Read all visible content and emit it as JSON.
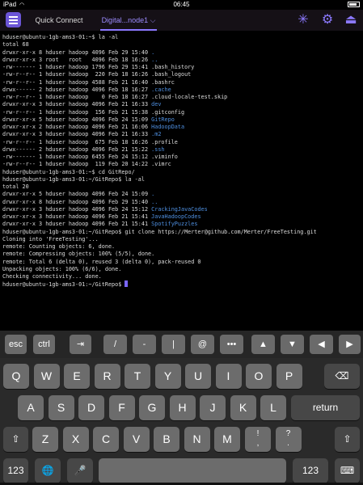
{
  "status": {
    "device": "iPad",
    "wifi": "wifi-icon",
    "time": "06:45",
    "battery": "battery-icon"
  },
  "nav": {
    "menu_icon": "menu-icon",
    "tabs": [
      {
        "label": "Quick Connect"
      },
      {
        "label": "Digital...node1 ⌵"
      }
    ],
    "icons": [
      "sparkle-icon",
      "gear-icon",
      "eject-icon"
    ],
    "accent": "#8c79ff"
  },
  "terminal": {
    "lines": [
      [
        {
          "t": "hduser@ubuntu-1gb-ams3-01:~$ la -al"
        }
      ],
      [
        {
          "t": "total 68"
        }
      ],
      [
        {
          "t": "drwxr-xr-x 8 hduser hadoop 4096 Feb 29 15:40 "
        },
        {
          "t": ".",
          "c": "blue"
        }
      ],
      [
        {
          "t": "drwxr-xr-x 3 root   root   4096 Feb 18 16:26 "
        },
        {
          "t": "..",
          "c": "blue"
        }
      ],
      [
        {
          "t": "-rw------- 1 hduser hadoop 1796 Feb 29 15:41 .bash_history"
        }
      ],
      [
        {
          "t": "-rw-r--r-- 1 hduser hadoop  220 Feb 18 16:26 .bash_logout"
        }
      ],
      [
        {
          "t": "-rw-r--r-- 1 hduser hadoop 4588 Feb 21 16:40 .bashrc"
        }
      ],
      [
        {
          "t": "drwx------ 2 hduser hadoop 4096 Feb 18 16:27 "
        },
        {
          "t": ".cache",
          "c": "blue"
        }
      ],
      [
        {
          "t": "-rw-r--r-- 1 hduser hadoop    0 Feb 18 16:27 .cloud-locale-test.skip"
        }
      ],
      [
        {
          "t": "drwxr-xr-x 3 hduser hadoop 4096 Feb 21 16:33 "
        },
        {
          "t": "dev",
          "c": "blue"
        }
      ],
      [
        {
          "t": "-rw-r--r-- 1 hduser hadoop  156 Feb 21 15:38 .gitconfig"
        }
      ],
      [
        {
          "t": "drwxr-xr-x 5 hduser hadoop 4096 Feb 24 15:09 "
        },
        {
          "t": "GitRepo",
          "c": "blue"
        }
      ],
      [
        {
          "t": "drwxr-xr-x 2 hduser hadoop 4096 Feb 21 16:06 "
        },
        {
          "t": "HadoopData",
          "c": "blue"
        }
      ],
      [
        {
          "t": "drwxr-xr-x 3 hduser hadoop 4096 Feb 21 16:33 "
        },
        {
          "t": ".m2",
          "c": "blue"
        }
      ],
      [
        {
          "t": "-rw-r--r-- 1 hduser hadoop  675 Feb 18 16:26 .profile"
        }
      ],
      [
        {
          "t": "drwx------ 2 hduser hadoop 4096 Feb 21 15:22 "
        },
        {
          "t": ".ssh",
          "c": "blue"
        }
      ],
      [
        {
          "t": "-rw------- 1 hduser hadoop 6455 Feb 24 15:12 .viminfo"
        }
      ],
      [
        {
          "t": "-rw-r--r-- 1 hduser hadoop  119 Feb 20 14:22 .vimrc"
        }
      ],
      [
        {
          "t": "hduser@ubuntu-1gb-ams3-01:~$ cd GitRepo/"
        }
      ],
      [
        {
          "t": "hduser@ubuntu-1gb-ams3-01:~/GitRepo$ la -al"
        }
      ],
      [
        {
          "t": "total 20"
        }
      ],
      [
        {
          "t": "drwxr-xr-x 5 hduser hadoop 4096 Feb 24 15:09 "
        },
        {
          "t": ".",
          "c": "blue"
        }
      ],
      [
        {
          "t": "drwxr-xr-x 8 hduser hadoop 4096 Feb 29 15:40 "
        },
        {
          "t": "..",
          "c": "blue"
        }
      ],
      [
        {
          "t": "drwxr-xr-x 3 hduser hadoop 4096 Feb 24 15:12 "
        },
        {
          "t": "CrackingJavaCodes",
          "c": "blue"
        }
      ],
      [
        {
          "t": "drwxr-xr-x 3 hduser hadoop 4096 Feb 21 15:41 "
        },
        {
          "t": "JavaHadoopCodes",
          "c": "blue"
        }
      ],
      [
        {
          "t": "drwxr-xr-x 3 hduser hadoop 4096 Feb 21 15:41 "
        },
        {
          "t": "SpotifyPuzzles",
          "c": "blue"
        }
      ],
      [
        {
          "t": "hduser@ubuntu-1gb-ams3-01:~/GitRepo$ git clone https://Merter@github.com/Merter/FreeTesting.git"
        }
      ],
      [
        {
          "t": "Cloning into 'FreeTesting'..."
        }
      ],
      [
        {
          "t": "remote: Counting objects: 6, done."
        }
      ],
      [
        {
          "t": "remote: Compressing objects: 100% (5/5), done."
        }
      ],
      [
        {
          "t": "remote: Total 6 (delta 0), reused 3 (delta 0), pack-reused 0"
        }
      ],
      [
        {
          "t": "Unpacking objects: 100% (6/6), done."
        }
      ],
      [
        {
          "t": "Checking connectivity... done."
        }
      ],
      [
        {
          "t": "hduser@ubuntu-1gb-ams3-01:~/GitRepo$ "
        }
      ]
    ]
  },
  "accessory_keys": [
    {
      "name": "esc-key",
      "label": "esc"
    },
    {
      "name": "ctrl-key",
      "label": "ctrl"
    },
    {
      "name": "tab-key",
      "label": "⇥"
    },
    {
      "name": "slash-key",
      "label": "/"
    },
    {
      "name": "minus-key",
      "label": "-"
    },
    {
      "name": "pipe-key",
      "label": "|"
    },
    {
      "name": "at-key",
      "label": "@"
    },
    {
      "name": "more-key",
      "label": "•••"
    },
    {
      "name": "arrow-up-key",
      "label": "▲"
    },
    {
      "name": "arrow-down-key",
      "label": "▼"
    },
    {
      "name": "arrow-left-key",
      "label": "◀"
    },
    {
      "name": "arrow-right-key",
      "label": "▶"
    }
  ],
  "keyboard": {
    "row1": [
      "Q",
      "W",
      "E",
      "R",
      "T",
      "Y",
      "U",
      "I",
      "O",
      "P"
    ],
    "row2": [
      "A",
      "S",
      "D",
      "F",
      "G",
      "H",
      "J",
      "K",
      "L"
    ],
    "row3": [
      "Z",
      "X",
      "C",
      "V",
      "B",
      "N",
      "M"
    ],
    "row3_punct": [
      [
        "!",
        ","
      ],
      [
        "?",
        "."
      ]
    ],
    "backspace": "⌫",
    "return": "return",
    "shift": "⇧",
    "numbers": "123",
    "globe": "🌐",
    "mic": "🎤",
    "hide_keyboard": "⌨"
  }
}
